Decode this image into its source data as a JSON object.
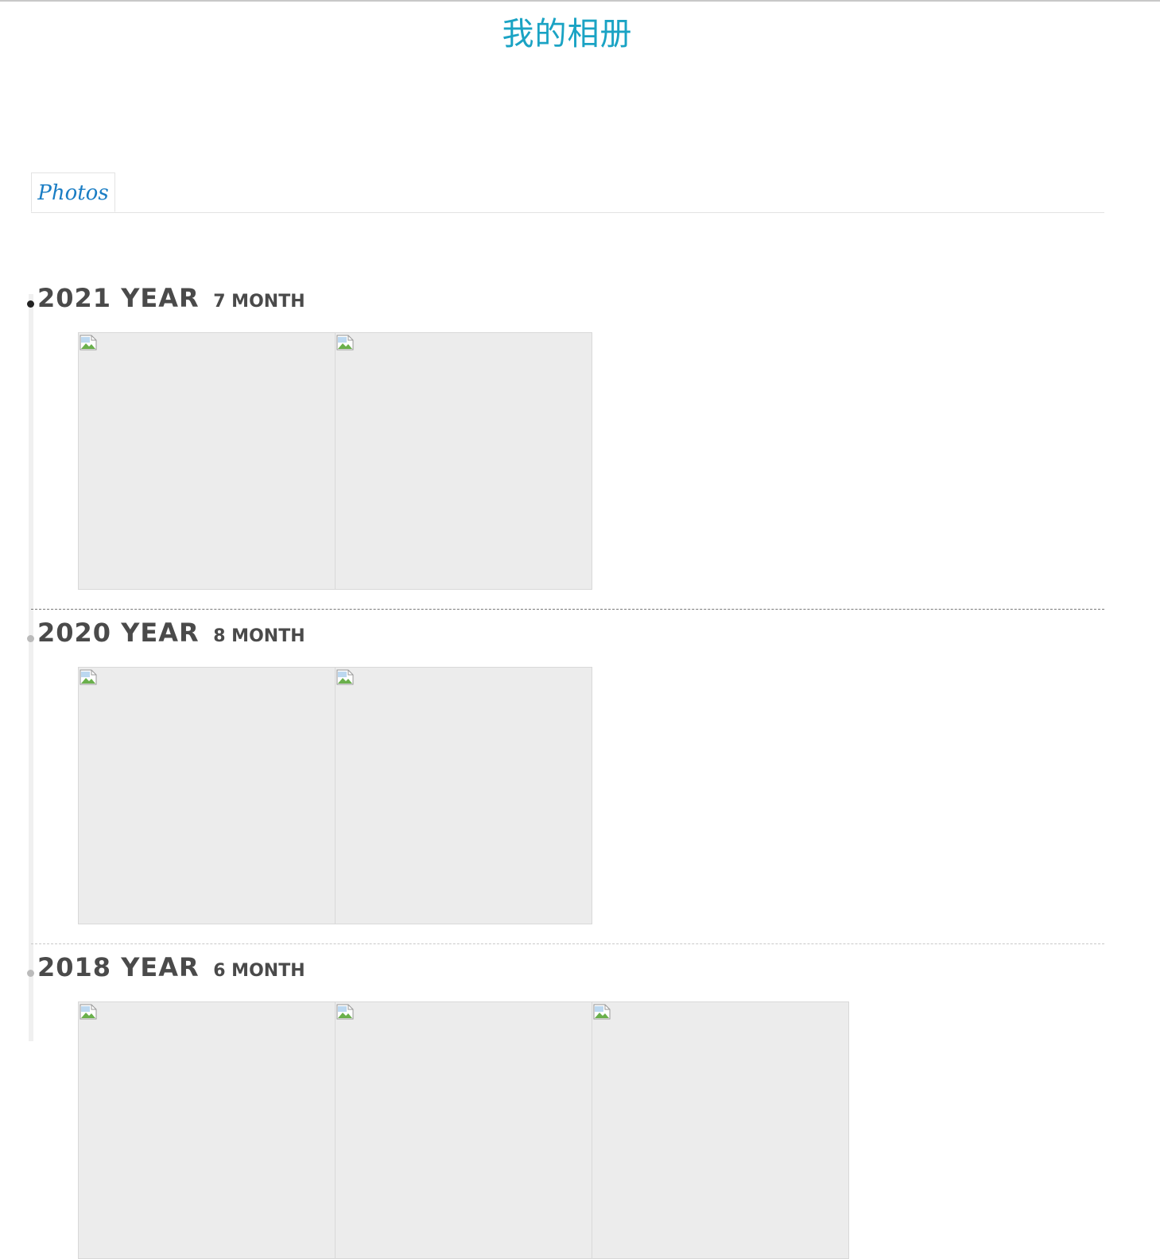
{
  "page": {
    "title": "我的相册"
  },
  "tabs": [
    {
      "label": "Photos"
    }
  ],
  "sections": [
    {
      "year": "2021 YEAR",
      "month": "7 MONTH",
      "photo_count": 2,
      "active": true
    },
    {
      "year": "2020 YEAR",
      "month": "8 MONTH",
      "photo_count": 2,
      "active": false
    },
    {
      "year": "2018 YEAR",
      "month": "6 MONTH",
      "photo_count": 3,
      "active": false
    }
  ],
  "colors": {
    "title": "#1aa3c4",
    "tab_text": "#1a7dc4",
    "heading_text": "#4a4a4a",
    "photo_placeholder": "#ececec",
    "active_dot": "#222222",
    "inactive_dot": "#bbbbbb"
  },
  "icons": {
    "photo": "broken-image-icon"
  }
}
